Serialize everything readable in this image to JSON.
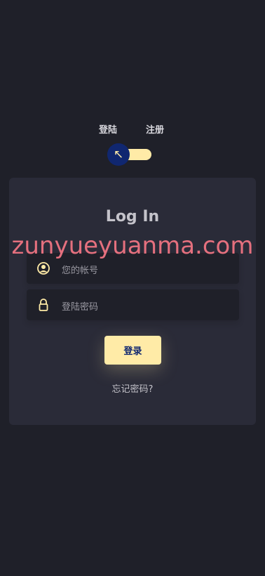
{
  "tabs": {
    "login": "登陆",
    "signup": "注册"
  },
  "toggle": {
    "icon": "arrow-up-left-icon",
    "glyph": "↖",
    "track_color": "#ffeba7",
    "knob_color": "#102770"
  },
  "card": {
    "title": "Log In"
  },
  "form": {
    "username_placeholder": "您的帐号",
    "password_placeholder": "登陆密码",
    "submit_label": "登录",
    "forgot_label": "忘记密码?"
  },
  "watermark": "zunyueyuanma.com",
  "colors": {
    "background": "#1f2029",
    "card": "#2a2b38",
    "accent": "#ffeba7",
    "accent_text": "#102770",
    "watermark": "#e5707e"
  }
}
